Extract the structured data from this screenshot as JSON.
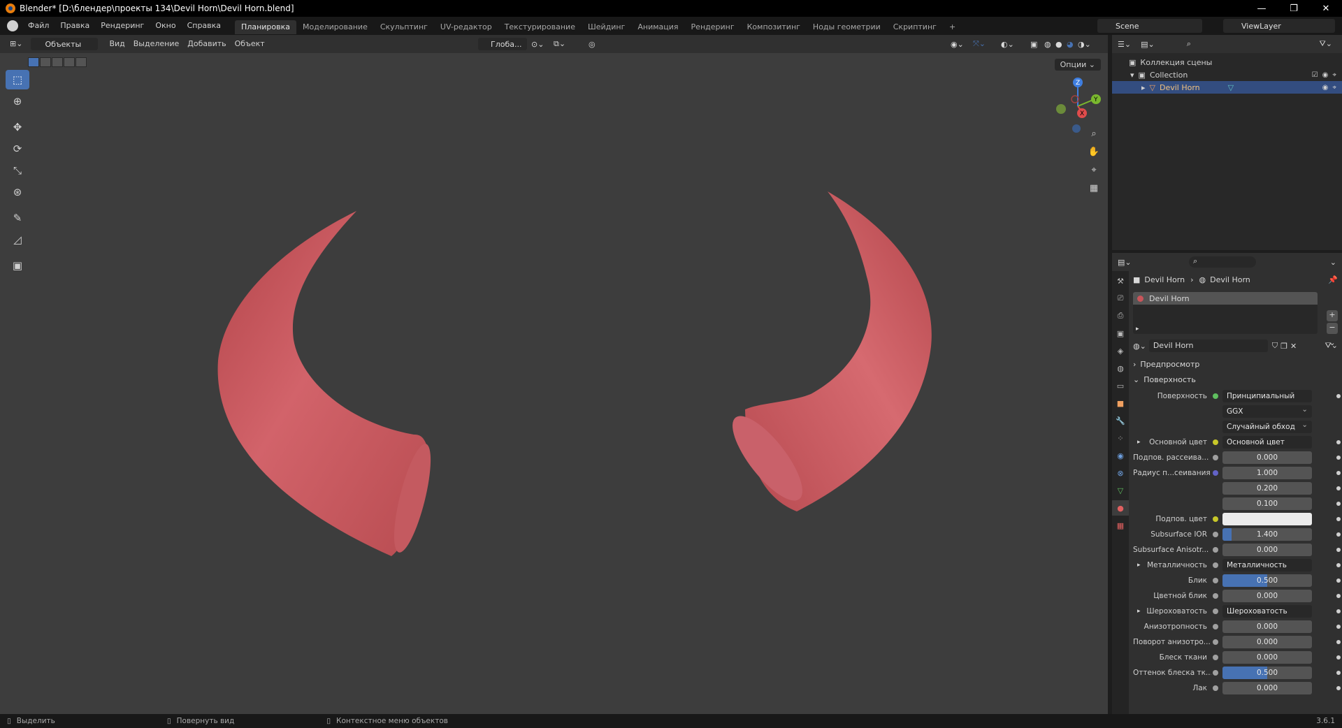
{
  "titlebar": {
    "title": "Blender* [D:\\блендер\\проекты 134\\Devil Horn\\Devil Horn.blend]",
    "minimize": "—",
    "maximize": "❐",
    "close": "✕"
  },
  "menu": [
    "Файл",
    "Правка",
    "Рендеринг",
    "Окно",
    "Справка"
  ],
  "workspaces": [
    "Планировка",
    "Моделирование",
    "Скульптинг",
    "UV-редактор",
    "Текстурирование",
    "Шейдинг",
    "Анимация",
    "Рендеринг",
    "Композитинг",
    "Ноды геометрии",
    "Скриптинг",
    "+"
  ],
  "scene": "Scene",
  "view_layer": "ViewLayer",
  "viewport_header": {
    "mode": "Объекты",
    "menus": [
      "Вид",
      "Выделение",
      "Добавить",
      "Объект"
    ],
    "orientation": "Глоба...",
    "options": "Опции"
  },
  "gizmo": {
    "z": "Z",
    "y": "Y",
    "x": "X"
  },
  "tools": [
    "select-box",
    "cursor",
    "move",
    "rotate",
    "scale",
    "transform",
    "annotate",
    "measure",
    "add-cube"
  ],
  "outliner": {
    "scene_collection": "Коллекция сцены",
    "collection": "Collection",
    "object": "Devil Horn"
  },
  "properties": {
    "breadcrumb_object": "Devil Horn",
    "breadcrumb_material": "Devil Horn",
    "slot_name": "Devil Horn",
    "material_name": "Devil Horn",
    "preview": "Предпросмотр",
    "surface_panel": "Поверхность",
    "rows": [
      {
        "label": "Поверхность",
        "type": "link",
        "value": "Принципиальный BSDF",
        "dot": "#5fbf5f"
      },
      {
        "label": "",
        "type": "dropdown",
        "value": "GGX"
      },
      {
        "label": "",
        "type": "dropdown",
        "value": "Случайный обход"
      },
      {
        "label": "Основной цвет",
        "type": "link",
        "value": "Основной цвет",
        "dot": "#c7c729",
        "expand": true
      },
      {
        "label": "Подпов. рассеива...",
        "type": "number",
        "value": "0.000",
        "dot": "#a0a0a0"
      },
      {
        "label": "Радиус п...сеивания",
        "type": "number",
        "value": "1.000",
        "dot": "#6363c7"
      },
      {
        "label": "",
        "type": "number",
        "value": "0.200"
      },
      {
        "label": "",
        "type": "number",
        "value": "0.100"
      },
      {
        "label": "Подпов. цвет",
        "type": "color",
        "value": "",
        "dot": "#c7c729"
      },
      {
        "label": "Subsurface IOR",
        "type": "number",
        "value": "1.400",
        "dot": "#a0a0a0",
        "fill": 0.1
      },
      {
        "label": "Subsurface Anisotr...",
        "type": "number",
        "value": "0.000",
        "dot": "#a0a0a0"
      },
      {
        "label": "Металличность",
        "type": "link",
        "value": "Металличность",
        "dot": "#a0a0a0",
        "expand": true
      },
      {
        "label": "Блик",
        "type": "number",
        "value": "0.500",
        "dot": "#a0a0a0",
        "fill": 0.5
      },
      {
        "label": "Цветной блик",
        "type": "number",
        "value": "0.000",
        "dot": "#a0a0a0"
      },
      {
        "label": "Шероховатость",
        "type": "link",
        "value": "Шероховатость",
        "dot": "#a0a0a0",
        "expand": true
      },
      {
        "label": "Анизотропность",
        "type": "number",
        "value": "0.000",
        "dot": "#a0a0a0"
      },
      {
        "label": "Поворот анизотро...",
        "type": "number",
        "value": "0.000",
        "dot": "#a0a0a0"
      },
      {
        "label": "Блеск ткани",
        "type": "number",
        "value": "0.000",
        "dot": "#a0a0a0"
      },
      {
        "label": "Оттенок блеска тк...",
        "type": "number",
        "value": "0.500",
        "dot": "#a0a0a0",
        "fill": 0.5
      },
      {
        "label": "Лак",
        "type": "number",
        "value": "0.000",
        "dot": "#a0a0a0"
      }
    ]
  },
  "statusbar": {
    "select": "Выделить",
    "rotate_view": "Повернуть вид",
    "context_menu": "Контекстное меню объектов",
    "version": "3.6.1"
  },
  "colors": {
    "accent": "#4772b3",
    "horn": "#c8555a",
    "selected_row": "#334d80"
  }
}
